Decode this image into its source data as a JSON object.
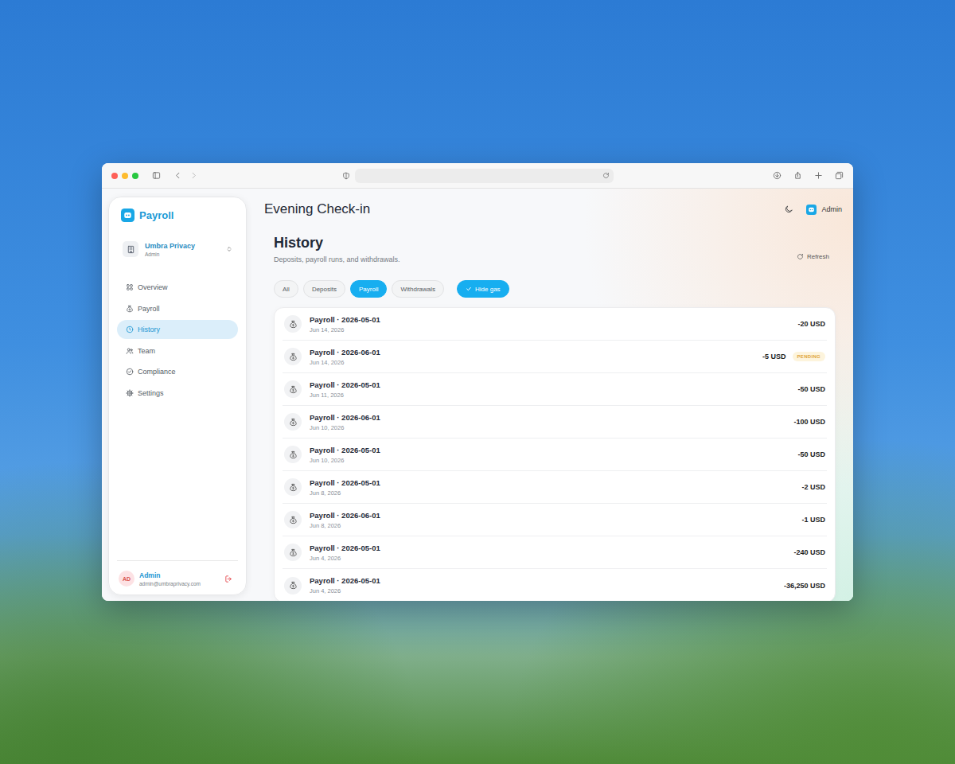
{
  "app": {
    "logo": "Payroll"
  },
  "org": {
    "name": "Umbra Privacy",
    "role": "Admin"
  },
  "sidebar": {
    "items": [
      {
        "label": "Overview",
        "selected": false
      },
      {
        "label": "Payroll",
        "selected": false
      },
      {
        "label": "History",
        "selected": true
      },
      {
        "label": "Team",
        "selected": false
      },
      {
        "label": "Compliance",
        "selected": false
      },
      {
        "label": "Settings",
        "selected": false
      }
    ]
  },
  "user": {
    "initials": "AD",
    "name": "Admin",
    "email": "admin@umbraprivacy.com"
  },
  "header": {
    "title": "Evening Check-in",
    "account": "Admin"
  },
  "page": {
    "title": "History",
    "subtitle": "Deposits, payroll runs, and withdrawals.",
    "refresh": "Refresh"
  },
  "filters": [
    {
      "label": "All",
      "selected": false
    },
    {
      "label": "Deposits",
      "selected": false
    },
    {
      "label": "Payroll",
      "selected": true
    },
    {
      "label": "Withdrawals",
      "selected": false
    }
  ],
  "hide_gas": {
    "label": "Hide gas",
    "checked": true
  },
  "rows": [
    {
      "title": "Payroll · 2026-05-01",
      "date": "Jun 14, 2026",
      "amount": "-20 USD"
    },
    {
      "title": "Payroll · 2026-06-01",
      "date": "Jun 14, 2026",
      "amount": "-5 USD",
      "badge": "PENDING"
    },
    {
      "title": "Payroll · 2026-05-01",
      "date": "Jun 11, 2026",
      "amount": "-50 USD"
    },
    {
      "title": "Payroll · 2026-06-01",
      "date": "Jun 10, 2026",
      "amount": "-100 USD"
    },
    {
      "title": "Payroll · 2026-05-01",
      "date": "Jun 10, 2026",
      "amount": "-50 USD"
    },
    {
      "title": "Payroll · 2026-05-01",
      "date": "Jun 8, 2026",
      "amount": "-2 USD"
    },
    {
      "title": "Payroll · 2026-06-01",
      "date": "Jun 8, 2026",
      "amount": "-1 USD"
    },
    {
      "title": "Payroll · 2026-05-01",
      "date": "Jun 4, 2026",
      "amount": "-240 USD"
    },
    {
      "title": "Payroll · 2026-05-01",
      "date": "Jun 4, 2026",
      "amount": "-36,250 USD"
    }
  ]
}
